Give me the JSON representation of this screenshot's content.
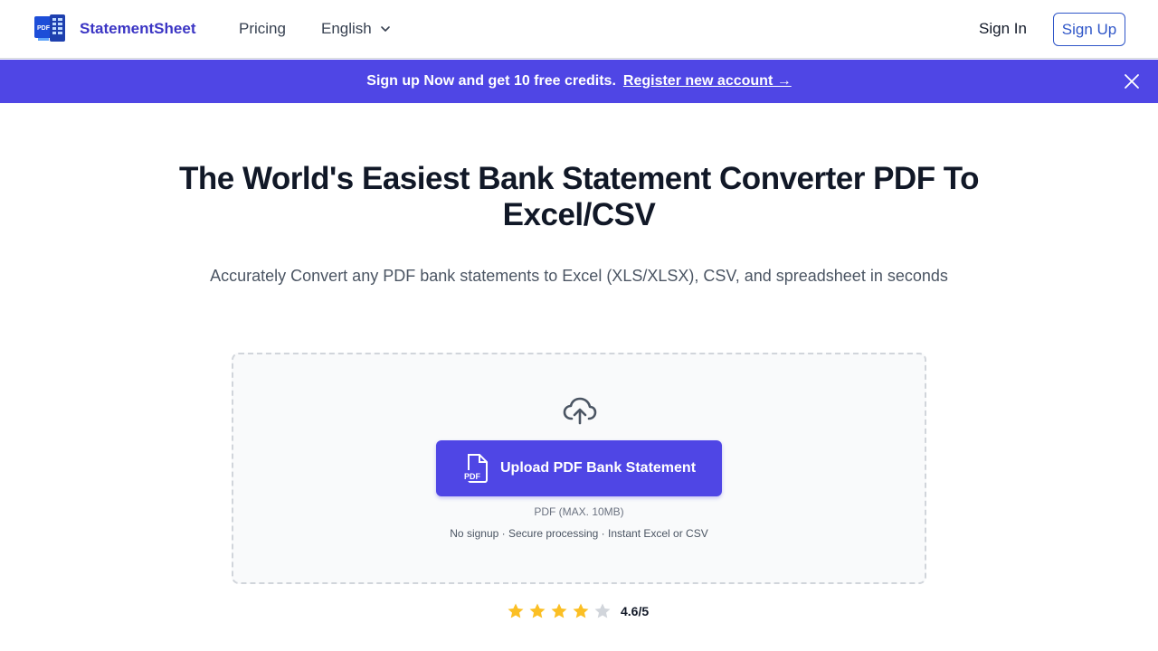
{
  "header": {
    "brand": "StatementSheet",
    "logo_badge": "PDF",
    "nav": {
      "pricing": "Pricing",
      "language": "English"
    },
    "sign_in": "Sign In",
    "sign_up": "Sign Up"
  },
  "banner": {
    "message": "Sign up Now and get 10 free credits.",
    "link": "Register new account →"
  },
  "hero": {
    "title": "The World's Easiest Bank Statement Converter PDF To Excel/CSV",
    "subtitle": "Accurately Convert any PDF bank statements to Excel (XLS/XLSX), CSV, and spreadsheet in seconds"
  },
  "upload": {
    "button_label": "Upload PDF Bank Statement",
    "file_icon_label": "PDF",
    "limit": "PDF (MAX. 10MB)",
    "features": "No signup · Secure processing · Instant Excel or CSV"
  },
  "rating": {
    "value": "4.6/5",
    "stars_filled": 4,
    "stars_total": 5
  },
  "colors": {
    "accent": "#4f46e5",
    "brand_text": "#3b35c4",
    "sign_up_border": "#2f56c8",
    "star_filled": "#fbbf24",
    "star_empty": "#d1d5db"
  },
  "icons": {
    "logo": "pdf-to-sheet-logo",
    "language_chevron": "chevron-down-icon",
    "banner_close": "close-icon",
    "dropzone": "cloud-upload-icon",
    "upload_button": "pdf-file-icon",
    "rating": "star-icon"
  }
}
